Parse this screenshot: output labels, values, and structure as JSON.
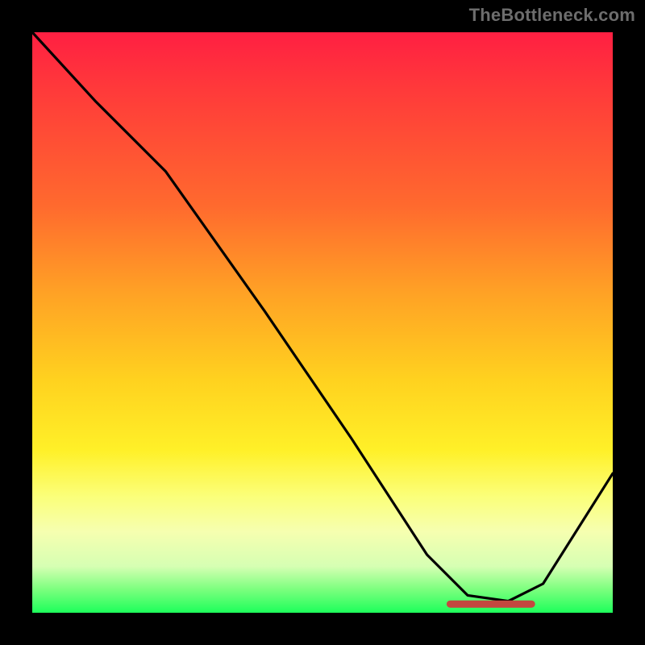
{
  "watermark": "TheBottleneck.com",
  "chart_data": {
    "type": "line",
    "title": "",
    "xlabel": "",
    "ylabel": "",
    "xlim": [
      0,
      100
    ],
    "ylim": [
      0,
      100
    ],
    "series": [
      {
        "name": "bottleneck-curve",
        "x": [
          0,
          11,
          23,
          40,
          55,
          68,
          75,
          82,
          88,
          100
        ],
        "values": [
          100,
          88,
          76,
          52,
          30,
          10,
          3,
          2,
          5,
          24
        ]
      }
    ],
    "annotations": [
      {
        "name": "minimum-band",
        "x_start": 72,
        "x_end": 86,
        "y": 1.5
      }
    ],
    "background_gradient": {
      "orientation": "vertical",
      "stops": [
        {
          "pos": 0.0,
          "color": "#ff1f42"
        },
        {
          "pos": 0.3,
          "color": "#ff6a2e"
        },
        {
          "pos": 0.6,
          "color": "#ffd21f"
        },
        {
          "pos": 0.8,
          "color": "#fbff7a"
        },
        {
          "pos": 0.92,
          "color": "#d6ffb3"
        },
        {
          "pos": 1.0,
          "color": "#1dff5b"
        }
      ]
    }
  }
}
